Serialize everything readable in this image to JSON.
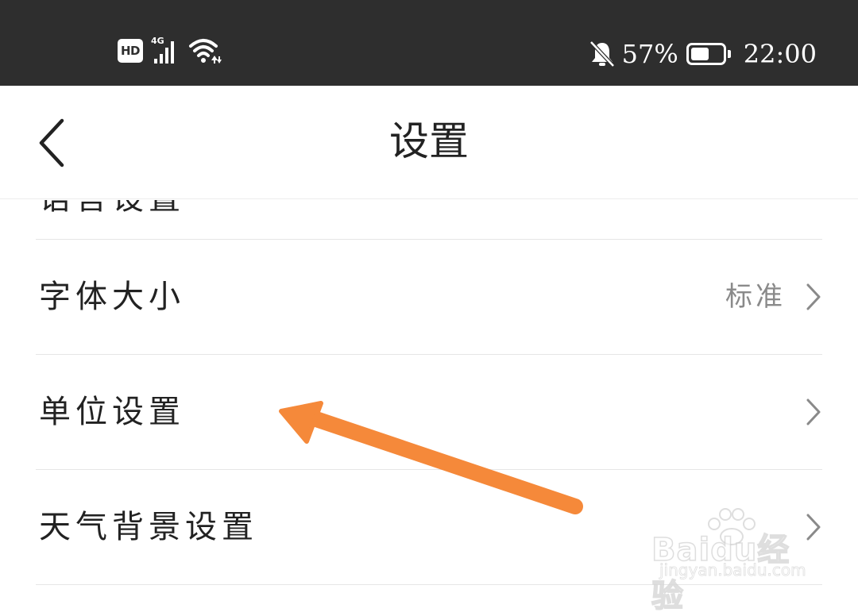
{
  "status_bar": {
    "hd_badge": "HD",
    "network_type": "4G",
    "battery_text": "57%",
    "battery_level": 0.57,
    "time": "22:00",
    "icons": [
      "signal-icon",
      "wifi-icon",
      "bell-off-icon",
      "battery-icon"
    ]
  },
  "header": {
    "title": "设置",
    "back_icon": "chevron-left-icon"
  },
  "settings": {
    "partial_label": "语言设置",
    "rows": [
      {
        "label": "字体大小",
        "value": "标准"
      },
      {
        "label": "单位设置",
        "value": ""
      },
      {
        "label": "天气背景设置",
        "value": ""
      }
    ]
  },
  "annotation": {
    "color": "#f5893a",
    "target": "单位设置"
  },
  "watermark": {
    "logo": "Baidu经验",
    "url": "jingyan.baidu.com"
  },
  "colors": {
    "status_bar_bg": "#2e2e2e",
    "text_primary": "#222222",
    "text_secondary": "#8a8a8a",
    "divider": "#e6e6e6"
  }
}
